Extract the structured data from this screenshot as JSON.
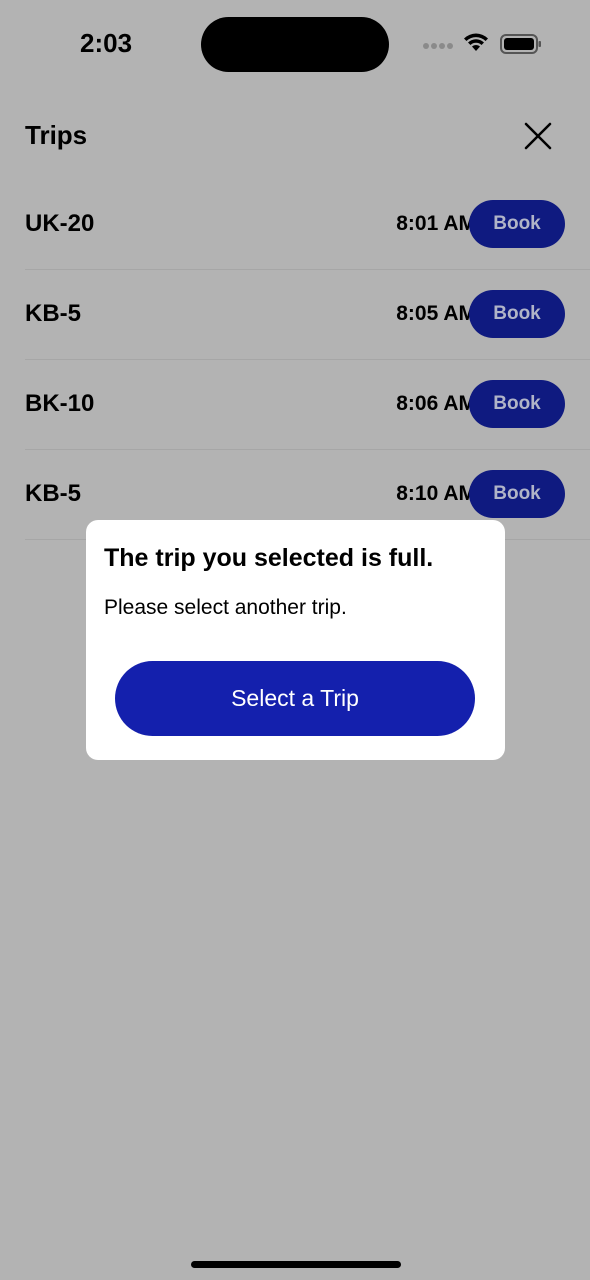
{
  "status_bar": {
    "time": "2:03"
  },
  "header": {
    "title": "Trips",
    "close_icon": "close-x-icon"
  },
  "trips": [
    {
      "route": "UK-20",
      "time": "8:01 AM",
      "action": "Book"
    },
    {
      "route": "KB-5",
      "time": "8:05 AM",
      "action": "Book"
    },
    {
      "route": "BK-10",
      "time": "8:06 AM",
      "action": "Book"
    },
    {
      "route": "KB-5",
      "time": "8:10 AM",
      "action": "Book"
    }
  ],
  "dialog": {
    "title": "The trip you selected is full.",
    "message": "Please select another trip.",
    "button_label": "Select a Trip"
  },
  "colors": {
    "overlay": "#b3b3b3",
    "book_button": "#0f1a80",
    "primary_button": "#1420ad"
  }
}
